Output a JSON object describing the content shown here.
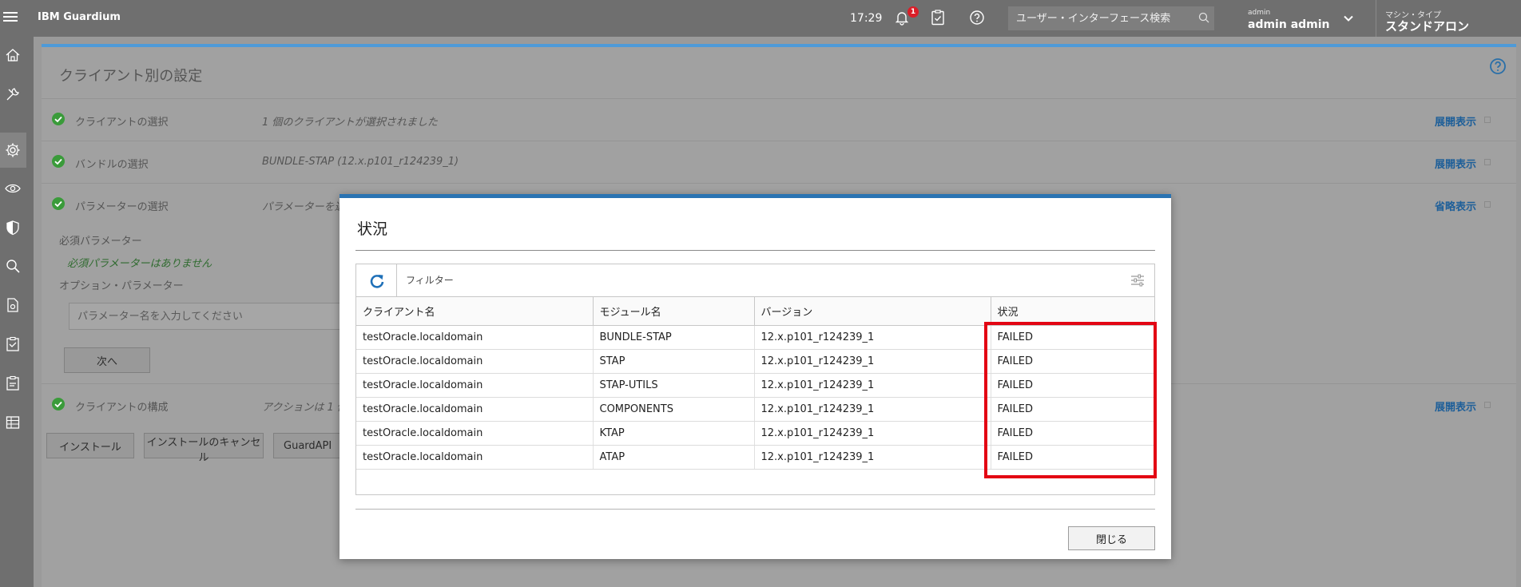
{
  "topbar": {
    "brand": "IBM Guardium",
    "time": "17:29",
    "notification_count": "1",
    "search_placeholder": "ユーザー・インターフェース検索",
    "user_role": "admin",
    "user_name": "admin admin",
    "machine_type_label": "マシン・タイプ",
    "machine_type_value": "スタンドアロン"
  },
  "sidebar": {
    "icons": [
      "home-icon",
      "tools-icon",
      "gear-icon",
      "eye-icon",
      "shield-icon",
      "search-icon",
      "document-icon",
      "clipboard-icon",
      "report-icon",
      "table-icon"
    ],
    "active": "gear-icon"
  },
  "page": {
    "title": "クライアント別の設定",
    "rows": [
      {
        "label": "クライアントの選択",
        "value": "1 個のクライアントが選択されました",
        "link": "展開表示"
      },
      {
        "label": "バンドルの選択",
        "value": "BUNDLE-STAP (12.x.p101_r124239_1)",
        "link": "展開表示"
      },
      {
        "label": "パラメーターの選択",
        "value": "パラメーターを選択",
        "link": "省略表示"
      },
      {
        "label": "クライアントの構成",
        "value": "アクションは 1 個の",
        "link": "展開表示"
      }
    ],
    "required_label": "必須パラメーター",
    "required_none": "必須パラメーターはありません",
    "optional_label": "オプション・パラメーター",
    "param_placeholder": "パラメーター名を入力してください",
    "next_button": "次へ",
    "install_button": "インストール",
    "cancel_install_button": "インストールのキャンセル",
    "guardapi_button": "GuardAPI"
  },
  "modal": {
    "title": "状況",
    "filter_placeholder": "フィルター",
    "columns": [
      "クライアント名",
      "モジュール名",
      "バージョン",
      "状況"
    ],
    "rows": [
      [
        "testOracle.localdomain",
        "BUNDLE-STAP",
        "12.x.p101_r124239_1",
        "FAILED"
      ],
      [
        "testOracle.localdomain",
        "STAP",
        "12.x.p101_r124239_1",
        "FAILED"
      ],
      [
        "testOracle.localdomain",
        "STAP-UTILS",
        "12.x.p101_r124239_1",
        "FAILED"
      ],
      [
        "testOracle.localdomain",
        "COMPONENTS",
        "12.x.p101_r124239_1",
        "FAILED"
      ],
      [
        "testOracle.localdomain",
        "KTAP",
        "12.x.p101_r124239_1",
        "FAILED"
      ],
      [
        "testOracle.localdomain",
        "ATAP",
        "12.x.p101_r124239_1",
        "FAILED"
      ]
    ],
    "close_button": "閉じる"
  },
  "colors": {
    "topbar": "#6f6f6f",
    "accent_blue": "#2a73b2",
    "success_green": "#3a9b3a",
    "highlight_red": "#e30613"
  }
}
